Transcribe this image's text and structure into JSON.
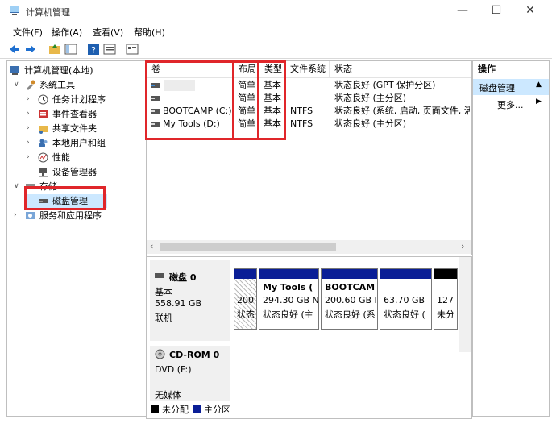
{
  "window": {
    "title": "计算机管理"
  },
  "menu": [
    "文件(F)",
    "操作(A)",
    "查看(V)",
    "帮助(H)"
  ],
  "tree": {
    "root": "计算机管理(本地)",
    "system_tools": "系统工具",
    "task_scheduler": "任务计划程序",
    "event_viewer": "事件查看器",
    "shared_folders": "共享文件夹",
    "local_users": "本地用户和组",
    "performance": "性能",
    "device_manager": "设备管理器",
    "storage": "存储",
    "disk_management": "磁盘管理",
    "services_apps": "服务和应用程序"
  },
  "volumes": {
    "headers": [
      "卷",
      "布局",
      "类型",
      "文件系统",
      "状态"
    ],
    "rows": [
      {
        "name": "",
        "layout": "简单",
        "type": "基本",
        "fs": "",
        "status": "状态良好 (GPT 保护分区)"
      },
      {
        "name": "",
        "layout": "简单",
        "type": "基本",
        "fs": "",
        "status": "状态良好 (主分区)"
      },
      {
        "name": "BOOTCAMP (C:)",
        "layout": "简单",
        "type": "基本",
        "fs": "NTFS",
        "status": "状态良好 (系统, 启动, 页面文件, 活动"
      },
      {
        "name": "My Tools (D:)",
        "layout": "简单",
        "type": "基本",
        "fs": "NTFS",
        "status": "状态良好 (主分区)"
      }
    ]
  },
  "disk0": {
    "name": "磁盘 0",
    "kind": "基本",
    "size": "558.91 GB",
    "status": "联机",
    "partitions": [
      {
        "line1": "",
        "line2": "200",
        "line3": "状态"
      },
      {
        "line1": "My Tools (",
        "line2": "294.30 GB N",
        "line3": "状态良好 (主"
      },
      {
        "line1": "BOOTCAM",
        "line2": "200.60 GB I",
        "line3": "状态良好 (系"
      },
      {
        "line1": "",
        "line2": "63.70 GB",
        "line3": "状态良好 ("
      },
      {
        "line1": "",
        "line2": "127",
        "line3": "未分"
      }
    ]
  },
  "cdrom": {
    "name": "CD-ROM 0",
    "kind": "DVD (F:)",
    "status": "无媒体"
  },
  "legend": {
    "unallocated": "未分配",
    "primary": "主分区"
  },
  "actions": {
    "header": "操作",
    "section": "磁盘管理",
    "more": "更多..."
  },
  "colors": {
    "primary_partition": "#0a1e96",
    "unallocated": "#000000",
    "highlight": "#e0262a",
    "selected": "#cce8ff"
  }
}
